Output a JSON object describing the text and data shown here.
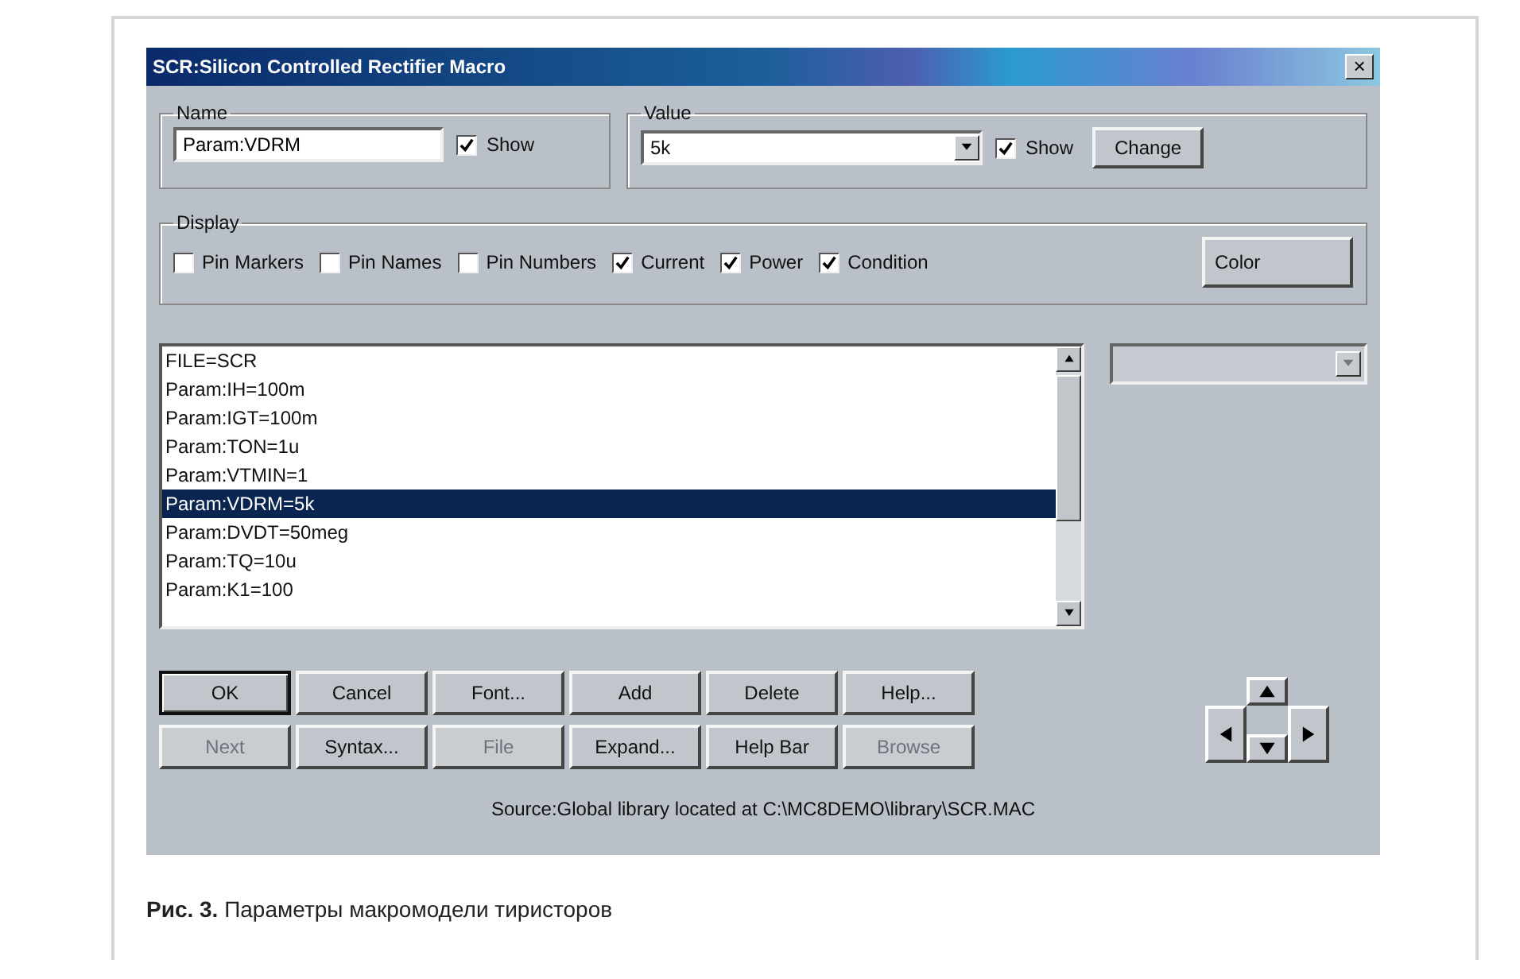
{
  "window": {
    "title": "SCR:Silicon Controlled Rectifier Macro",
    "close": "×"
  },
  "name_group": {
    "label": "Name",
    "value": "Param:VDRM",
    "show": {
      "label": "Show",
      "checked": true
    }
  },
  "value_group": {
    "label": "Value",
    "value": "5k",
    "show": {
      "label": "Show",
      "checked": true
    },
    "button": "Change"
  },
  "display": {
    "label": "Display",
    "options": [
      {
        "label": "Pin Markers",
        "checked": false
      },
      {
        "label": "Pin Names",
        "checked": false
      },
      {
        "label": "Pin Numbers",
        "checked": false
      },
      {
        "label": "Current",
        "checked": true
      },
      {
        "label": "Power",
        "checked": true
      },
      {
        "label": "Condition",
        "checked": true
      }
    ],
    "button": "Color"
  },
  "list": {
    "items": [
      {
        "text": "FILE=SCR",
        "selected": false
      },
      {
        "text": "Param:IH=100m",
        "selected": false
      },
      {
        "text": "Param:IGT=100m",
        "selected": false
      },
      {
        "text": "Param:TON=1u",
        "selected": false
      },
      {
        "text": "Param:VTMIN=1",
        "selected": false
      },
      {
        "text": "Param:VDRM=5k",
        "selected": true
      },
      {
        "text": "Param:DVDT=50meg",
        "selected": false
      },
      {
        "text": "Param:TQ=10u",
        "selected": false
      },
      {
        "text": "Param:K1=100",
        "selected": false
      }
    ]
  },
  "buttons": [
    {
      "label": "OK",
      "disabled": false,
      "default": true
    },
    {
      "label": "Cancel",
      "disabled": false,
      "default": false
    },
    {
      "label": "Font...",
      "disabled": false,
      "default": false
    },
    {
      "label": "Add",
      "disabled": false,
      "default": false
    },
    {
      "label": "Delete",
      "disabled": false,
      "default": false
    },
    {
      "label": "Help...",
      "disabled": false,
      "default": false
    },
    {
      "label": "Next",
      "disabled": true,
      "default": false
    },
    {
      "label": "Syntax...",
      "disabled": false,
      "default": false
    },
    {
      "label": "File",
      "disabled": true,
      "default": false
    },
    {
      "label": "Expand...",
      "disabled": false,
      "default": false
    },
    {
      "label": "Help Bar",
      "disabled": false,
      "default": false
    },
    {
      "label": "Browse",
      "disabled": true,
      "default": false
    }
  ],
  "source": "Source:Global library located at C:\\MC8DEMO\\library\\SCR.MAC",
  "caption": "**Рис. 3.** Параметры макромодели тиристоров"
}
